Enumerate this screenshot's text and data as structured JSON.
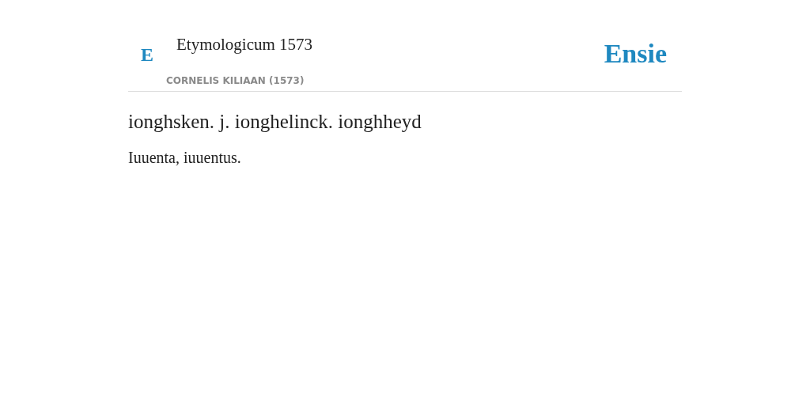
{
  "header": {
    "badge": "E",
    "title": "Etymologicum 1573",
    "author": "CORNELIS KILIAAN (1573)",
    "brand": "Ensie"
  },
  "entry": {
    "headword": "ionghsken. j. ionghelinck. ionghheyd",
    "definition": "Iuuenta, iuuentus."
  }
}
